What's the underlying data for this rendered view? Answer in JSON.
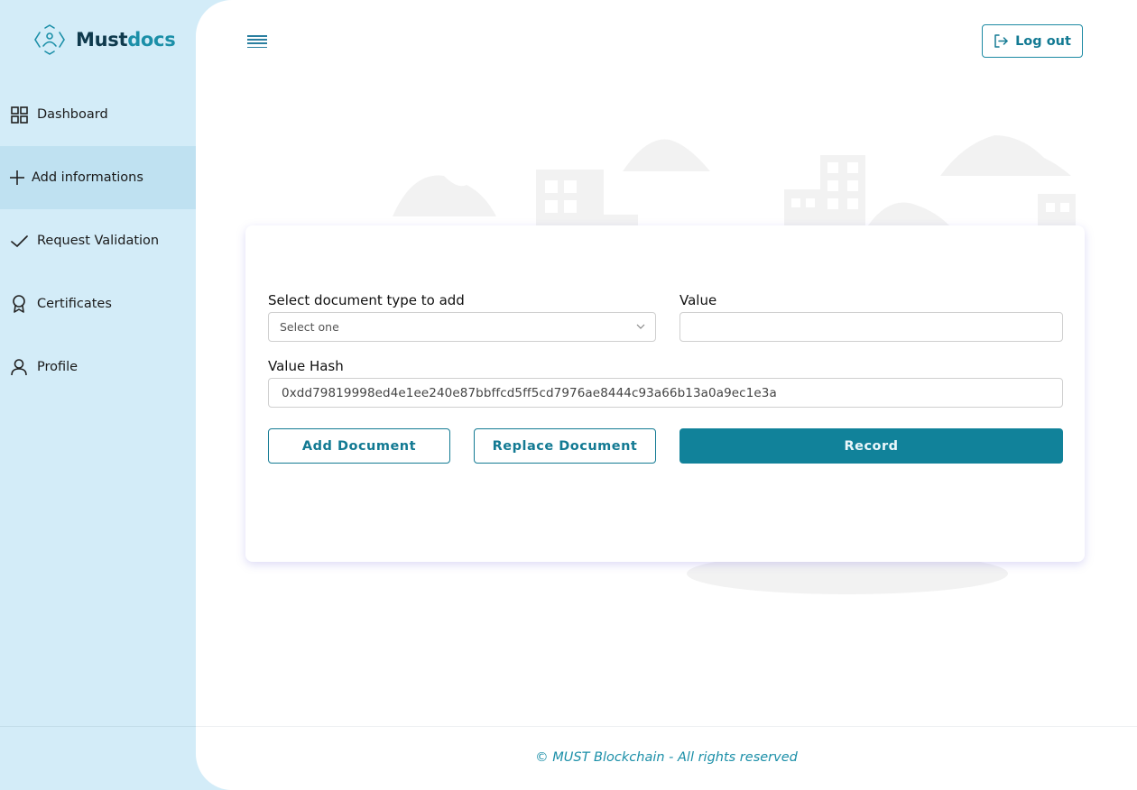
{
  "app": {
    "logo_text_main": "Must",
    "logo_text_accent": "docs"
  },
  "sidebar": {
    "items": [
      {
        "label": "Dashboard",
        "icon": "grid-icon",
        "active": false
      },
      {
        "label": "Add informations",
        "icon": "plus-icon",
        "active": true
      },
      {
        "label": "Request Validation",
        "icon": "check-icon",
        "active": false
      },
      {
        "label": "Certificates",
        "icon": "award-icon",
        "active": false
      },
      {
        "label": "Profile",
        "icon": "user-icon",
        "active": false
      }
    ]
  },
  "header": {
    "logout_label": "Log out"
  },
  "form": {
    "doc_type_label": "Select document type to add",
    "doc_type_selected": "Select one",
    "value_label": "Value",
    "value_value": "",
    "hash_label": "Value Hash",
    "hash_value": "0xdd79819998ed4e1ee240e87bbffcd5ff5cd7976ae8444c93a66b13a0a9ec1e3a",
    "add_button": "Add Document",
    "replace_button": "Replace Document",
    "record_button": "Record"
  },
  "footer": {
    "text": "© MUST Blockchain - All rights reserved"
  },
  "colors": {
    "sidebar_bg": "#d3ecf8",
    "sidebar_active": "#bfe1f1",
    "accent": "#11829a",
    "footer_text": "#1b8fa8"
  }
}
